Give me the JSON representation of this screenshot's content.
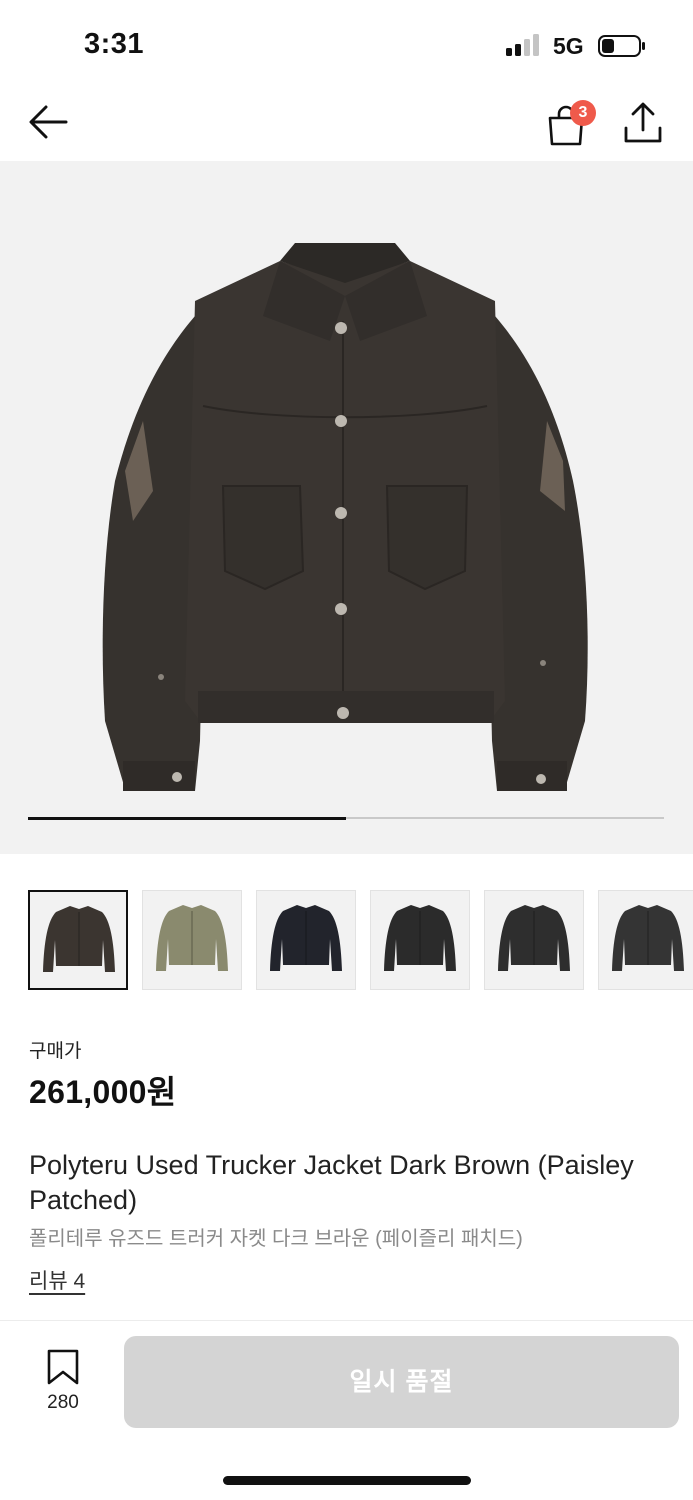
{
  "status_bar": {
    "time": "3:31",
    "network": "5G",
    "battery_level": 0.35
  },
  "header": {
    "cart_count": "3"
  },
  "gallery": {
    "image_count": 2,
    "current_index": 1
  },
  "thumbnails": [
    {
      "color": "#3b3530"
    },
    {
      "color": "#8a8a6e"
    },
    {
      "color": "#22242c"
    },
    {
      "color": "#2b2b2b"
    },
    {
      "color": "#2e2e2e"
    },
    {
      "color": "#343434"
    }
  ],
  "product": {
    "price_label": "구매가",
    "price": "261,000원",
    "name_en": "Polyteru Used Trucker Jacket Dark Brown (Paisley Patched)",
    "name_ko": "폴리테루 유즈드 트러커 자켓 다크 브라운 (페이즐리 패치드)",
    "review_link": "리뷰 4"
  },
  "bottom_bar": {
    "bookmark_count": "280",
    "cta_label": "일시 품절"
  },
  "colors": {
    "badge": "#ef5a4b",
    "disabled_button": "#d4d4d4",
    "hero_background": "#f2f2f2",
    "jacket": "#3a3531"
  }
}
